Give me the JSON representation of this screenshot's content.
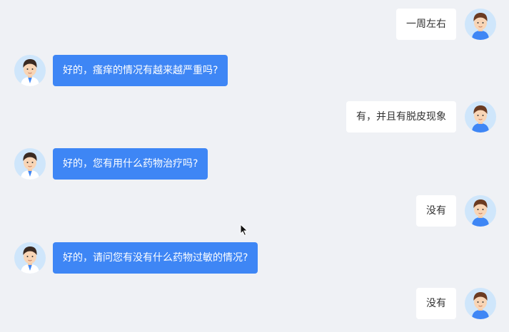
{
  "messages": [
    {
      "role": "patient",
      "text": "一周左右"
    },
    {
      "role": "doctor",
      "text": "好的，瘙痒的情况有越来越严重吗?"
    },
    {
      "role": "patient",
      "text": "有，并且有脱皮现象"
    },
    {
      "role": "doctor",
      "text": "好的，您有用什么药物治疗吗?"
    },
    {
      "role": "patient",
      "text": "没有"
    },
    {
      "role": "doctor",
      "text": "好的，请问您有没有什么药物过敏的情况?"
    },
    {
      "role": "patient",
      "text": "没有"
    }
  ],
  "colors": {
    "background": "#eff1f5",
    "doctor_bubble": "#3e86f5",
    "patient_bubble": "#ffffff",
    "avatar_bg": "#cfe6fb"
  },
  "icons": {
    "patient_avatar": "patient-avatar-icon",
    "doctor_avatar": "doctor-avatar-icon",
    "cursor": "mouse-cursor-icon"
  }
}
